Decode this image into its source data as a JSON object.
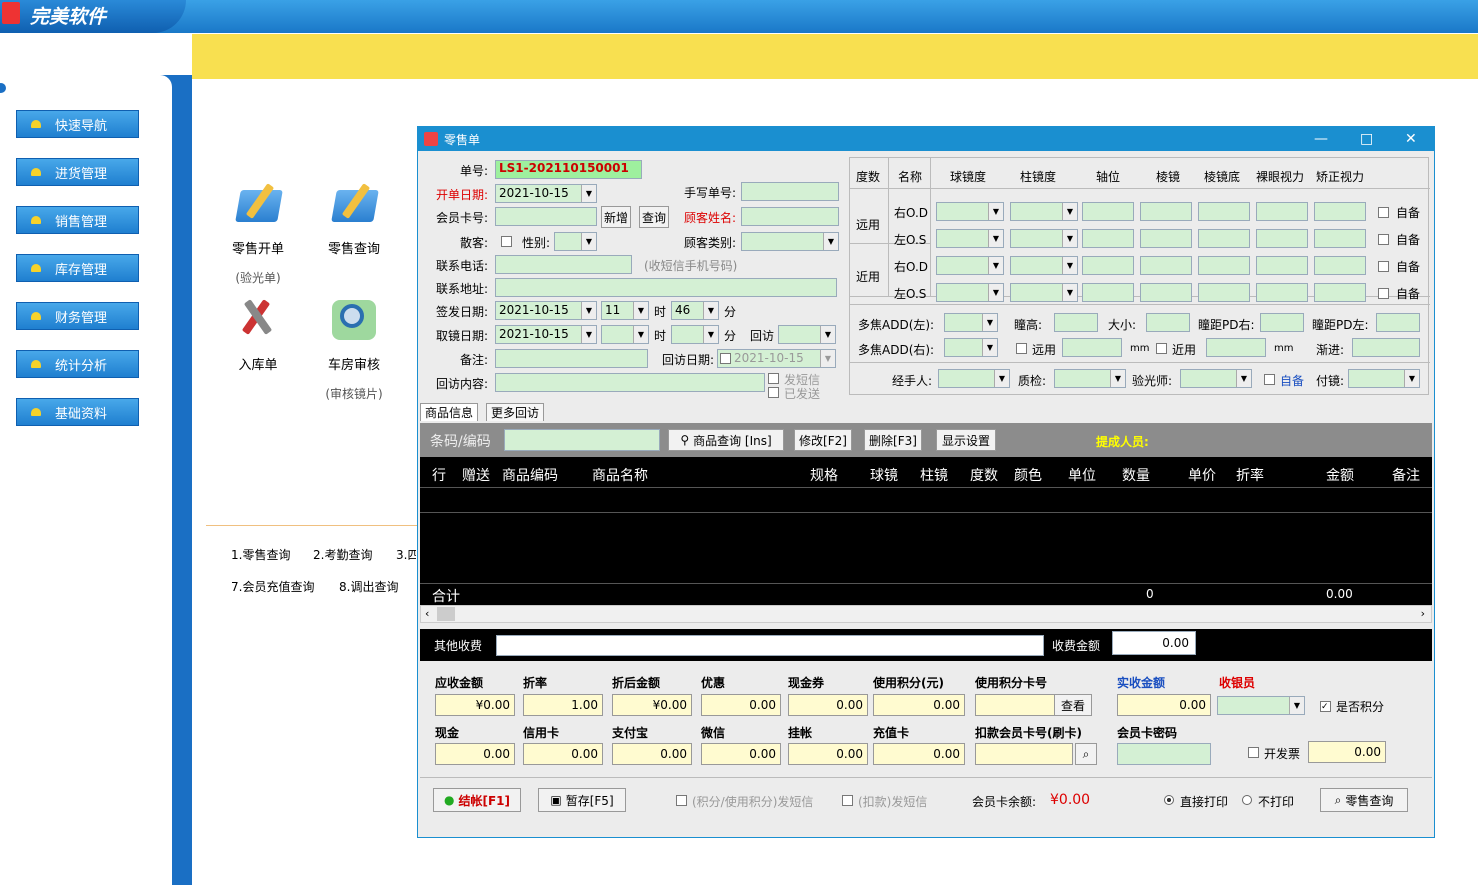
{
  "app": {
    "brand": "完美软件"
  },
  "sidebar": {
    "items": [
      "快速导航",
      "进货管理",
      "销售管理",
      "库存管理",
      "财务管理",
      "统计分析",
      "基础资料"
    ]
  },
  "shortcuts": [
    {
      "label": "零售开单",
      "sub": "(验光单)"
    },
    {
      "label": "零售查询",
      "sub": ""
    },
    {
      "label": "入库单",
      "sub": ""
    },
    {
      "label": "车房审核",
      "sub": "(审核镜片)"
    }
  ],
  "quicklinks": [
    "1.零售查询",
    "2.考勤查询",
    "3.四",
    "7.会员充值查询",
    "8.调出查询"
  ],
  "dialog": {
    "title": "零售单",
    "controls": {
      "min": "—",
      "max": "□",
      "close": "✕"
    },
    "labels": {
      "order_no": "单号:",
      "open_date": "开单日期:",
      "manual_no": "手写单号:",
      "member_card": "会员卡号:",
      "new_btn": "新增",
      "query_btn": "查询",
      "customer_name": "顾客姓名:",
      "walkin": "散客:",
      "gender": "性别:",
      "customer_type": "顾客类别:",
      "phone": "联系电话:",
      "phone_hint": "(收短信手机号码)",
      "address": "联系地址:",
      "issue_date": "签发日期:",
      "hour": "时",
      "minute": "分",
      "pickup_date": "取镜日期:",
      "revisit": "回访",
      "note": "备注:",
      "revisit_date": "回访日期:",
      "revisit_content": "回访内容:",
      "sms_sent": "发短信",
      "sent": "已发送"
    },
    "values": {
      "order_no": "LS1-202110150001",
      "open_date": "2021-10-15",
      "issue_date": "2021-10-15",
      "issue_hour": "11",
      "issue_min": "46",
      "pickup_date": "2021-10-15",
      "revisit_date": "2021-10-15"
    },
    "grid": {
      "headers": [
        "度数",
        "名称",
        "球镜度",
        "柱镜度",
        "轴位",
        "棱镜",
        "棱镜底",
        "裸眼视力",
        "矫正视力"
      ],
      "groups": [
        "远用",
        "近用"
      ],
      "rows": [
        "右O.D",
        "左O.S",
        "右O.D",
        "左O.S"
      ],
      "self": "自备",
      "add_right": "多焦ADD(左):",
      "add_left": "多焦ADD(右):",
      "pupil_h": "瞳高:",
      "size": "大小:",
      "pd_right": "瞳距PD右:",
      "pd_left": "瞳距PD左:",
      "far": "远用",
      "near": "近用",
      "mm": "mm",
      "mm2": "mm",
      "progress": "渐进:",
      "handler": "经手人:",
      "qc": "质检:",
      "optometrist": "验光师:",
      "self2": "自备",
      "fitting": "付镜:"
    },
    "tabs": [
      "商品信息",
      "更多回访"
    ],
    "toolbar": {
      "barcode": "条码/编码",
      "goods_query": "商品查询 [Ins]",
      "modify": "修改[F2]",
      "delete": "删除[F3]",
      "display": "显示设置",
      "commission": "提成人员:"
    },
    "table": {
      "headers": [
        "行",
        "赠送",
        "商品编码",
        "商品名称",
        "规格",
        "球镜",
        "柱镜",
        "度数",
        "颜色",
        "单位",
        "数量",
        "单价",
        "折率",
        "金额",
        "备注"
      ],
      "total_label": "合计",
      "total_qty": "0",
      "total_amount": "0.00"
    },
    "fees": {
      "other": "其他收费",
      "fee_amount_label": "收费金额",
      "fee_amount": "0.00"
    },
    "money": {
      "labels": [
        "应收金额",
        "折率",
        "折后金额",
        "优惠",
        "现金券",
        "使用积分(元)",
        "使用积分卡号",
        "实收金额",
        "收银员"
      ],
      "values": [
        "¥0.00",
        "1.00",
        "¥0.00",
        "0.00",
        "0.00",
        "0.00",
        "",
        "0.00",
        ""
      ],
      "view_btn": "查看",
      "labels2": [
        "现金",
        "信用卡",
        "支付宝",
        "微信",
        "挂帐",
        "充值卡",
        "扣款会员卡号(刷卡)",
        "会员卡密码"
      ],
      "values2": [
        "0.00",
        "0.00",
        "0.00",
        "0.00",
        "0.00",
        "0.00"
      ],
      "points": "是否积分",
      "invoice": "开发票",
      "invoice_amt": "0.00"
    },
    "footer": {
      "checkout": "结帐[F1]",
      "hold": "暂存[F5]",
      "sms_points": "(积分/使用积分)发短信",
      "sms_deduct": "(扣款)发短信",
      "balance_label": "会员卡余额:",
      "balance": "¥0.00",
      "print_direct": "直接打印",
      "no_print": "不打印",
      "retail_query": "零售查询"
    }
  }
}
